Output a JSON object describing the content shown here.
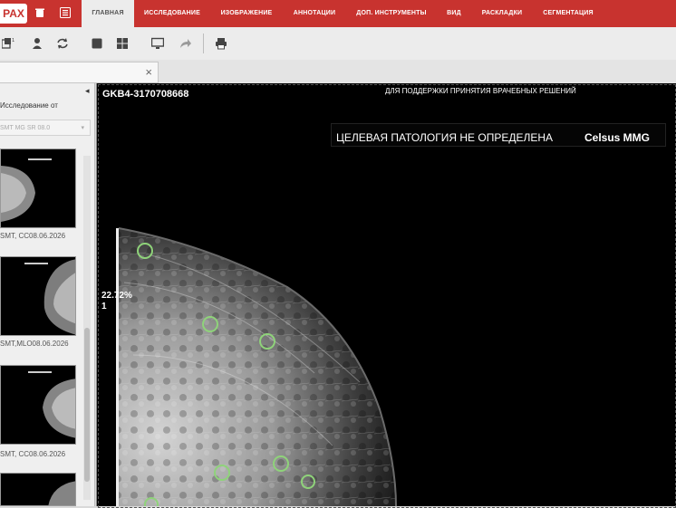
{
  "header": {
    "logo_text": "PAX",
    "tabs": [
      {
        "label": "ГЛАВНАЯ",
        "active": true
      },
      {
        "label": "ИССЛЕДОВАНИЕ",
        "active": false
      },
      {
        "label": "ИЗОБРАЖЕНИЕ",
        "active": false
      },
      {
        "label": "АННОТАЦИИ",
        "active": false
      },
      {
        "label": "ДОП. ИНСТРУМЕНТЫ",
        "active": false
      },
      {
        "label": "ВИД",
        "active": false
      },
      {
        "label": "РАСКЛАДКИ",
        "active": false
      },
      {
        "label": "СЕГМЕНТАЦИЯ",
        "active": false
      }
    ],
    "accent_color": "#c8332f"
  },
  "toolbar": {
    "icons": [
      "series-icon",
      "download-icon",
      "refresh-icon",
      "single-layout-icon",
      "grid-layout-icon",
      "monitor-icon",
      "share-icon",
      "print-icon"
    ]
  },
  "file_tab": {
    "close_symbol": "×"
  },
  "left_panel": {
    "study_label": "Исследование от",
    "study_select_value": "SMT MG SR 08.0",
    "thumbnails": [
      {
        "label": "SMT,  CC08.06.2026",
        "view": "CC"
      },
      {
        "label": "SMT,MLO08.06.2026",
        "view": "MLO"
      },
      {
        "label": "SMT,  CC08.06.2026",
        "view": "CC"
      }
    ],
    "collapse_symbol": "◂"
  },
  "viewer": {
    "study_id": "GKB4-3170708668",
    "support_text": "ДЛЯ ПОДДЕРЖКИ ПРИНЯТИЯ ВРАЧЕБНЫХ РЕШЕНИЙ",
    "pathology_text": "ЦЕЛЕВАЯ ПАТОЛОГИЯ НЕ ОПРЕДЕЛЕНА",
    "brand_text": "Celsus MMG",
    "density_value": "22.72%",
    "density_category": "1",
    "marker_color": "#8fd37a",
    "marker_count": 7
  }
}
